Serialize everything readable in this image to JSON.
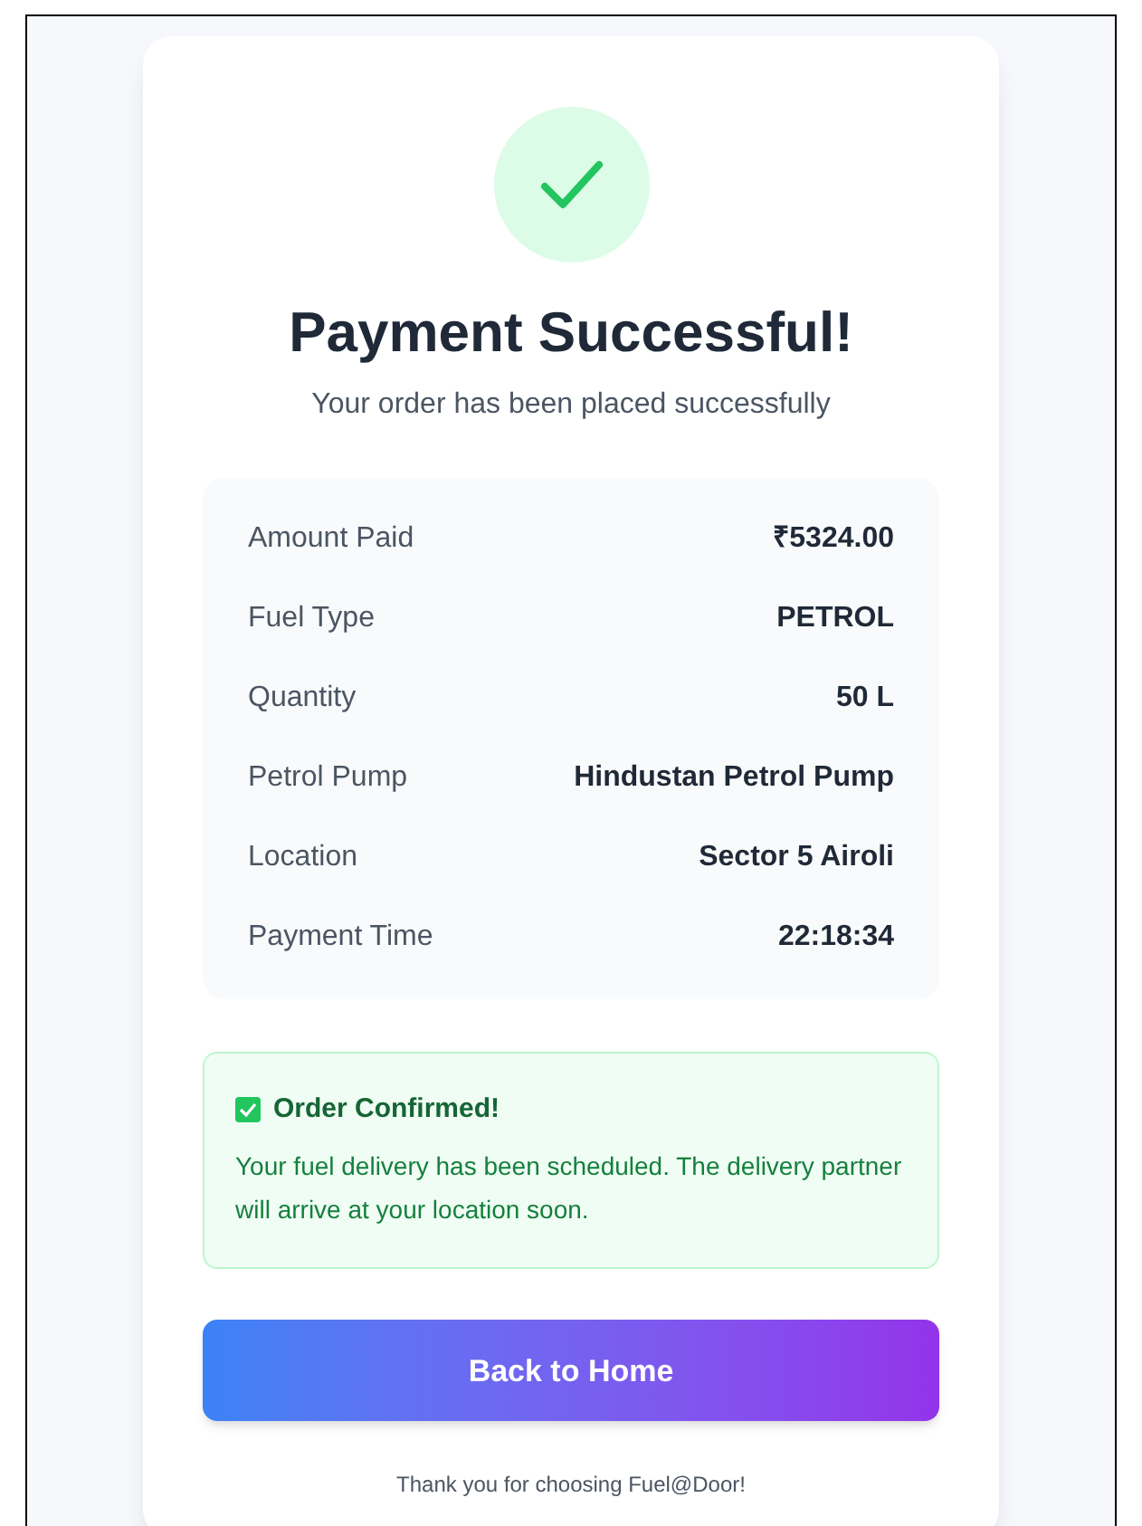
{
  "header": {
    "title": "Payment Successful!",
    "subtitle": "Your order has been placed successfully"
  },
  "details": [
    {
      "label": "Amount Paid",
      "value": "₹5324.00"
    },
    {
      "label": "Fuel Type",
      "value": "PETROL"
    },
    {
      "label": "Quantity",
      "value": "50 L"
    },
    {
      "label": "Petrol Pump",
      "value": "Hindustan Petrol Pump"
    },
    {
      "label": "Location",
      "value": "Sector 5 Airoli"
    },
    {
      "label": "Payment Time",
      "value": "22:18:34"
    }
  ],
  "notice": {
    "title": "Order Confirmed!",
    "checked": true,
    "message": "Your fuel delivery has been scheduled. The delivery partner will arrive at your location soon."
  },
  "button": {
    "label": "Back to Home"
  },
  "footer": "Thank you for choosing Fuel@Door!"
}
